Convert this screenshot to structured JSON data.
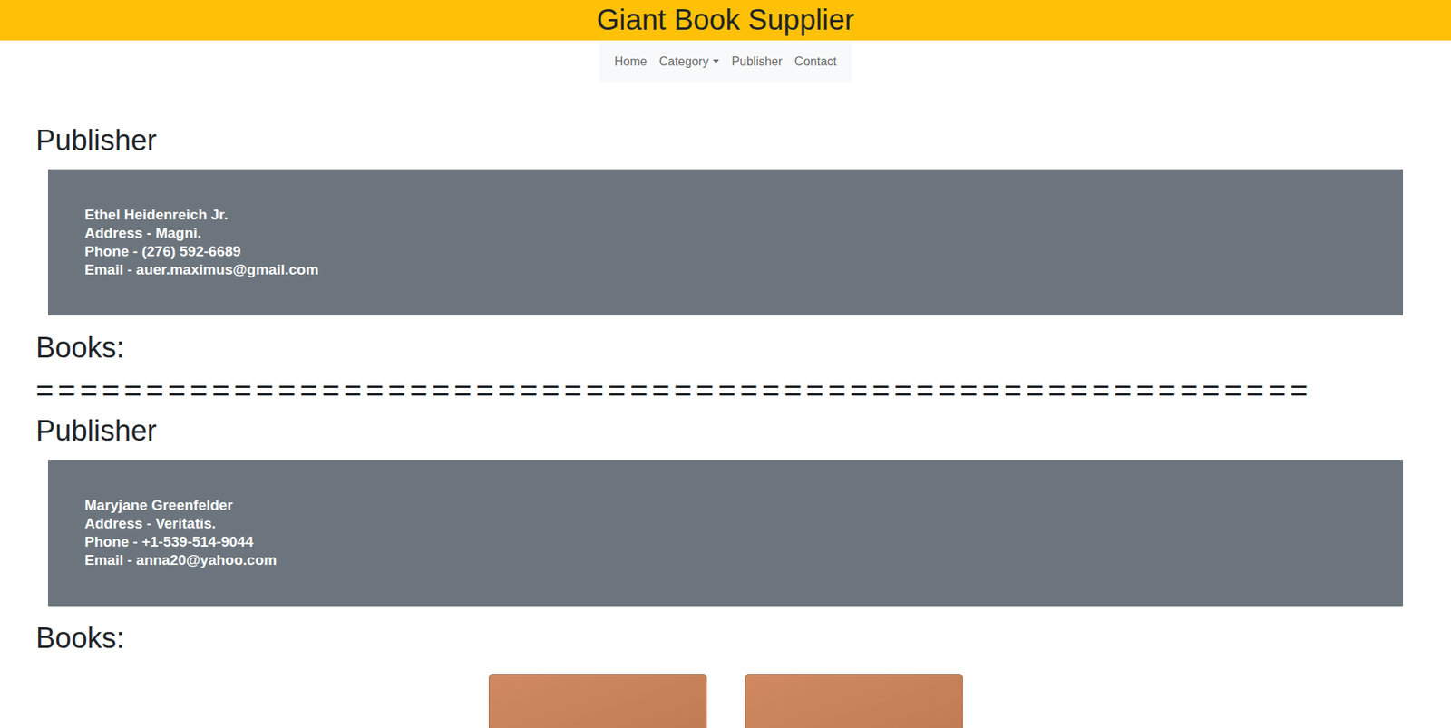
{
  "header": {
    "title": "Giant Book Supplier"
  },
  "nav": {
    "items": [
      {
        "label": "Home",
        "dropdown": false
      },
      {
        "label": "Category",
        "dropdown": true
      },
      {
        "label": "Publisher",
        "dropdown": false
      },
      {
        "label": "Contact",
        "dropdown": false
      }
    ]
  },
  "separator": "==========================================================",
  "publishers": [
    {
      "heading": "Publisher",
      "name": "Ethel Heidenreich Jr.",
      "address": "Address - Magni.",
      "phone": "Phone - (276) 592-6689",
      "email": "Email - auer.maximus@gmail.com",
      "books_heading": "Books:",
      "books": []
    },
    {
      "heading": "Publisher",
      "name": "Maryjane Greenfelder",
      "address": "Address - Veritatis.",
      "phone": "Phone - +1-539-514-9044",
      "email": "Email - anna20@yahoo.com",
      "books_heading": "Books:",
      "books": [
        {
          "color": "#c9794a"
        },
        {
          "color": "#c9794a"
        }
      ]
    }
  ]
}
